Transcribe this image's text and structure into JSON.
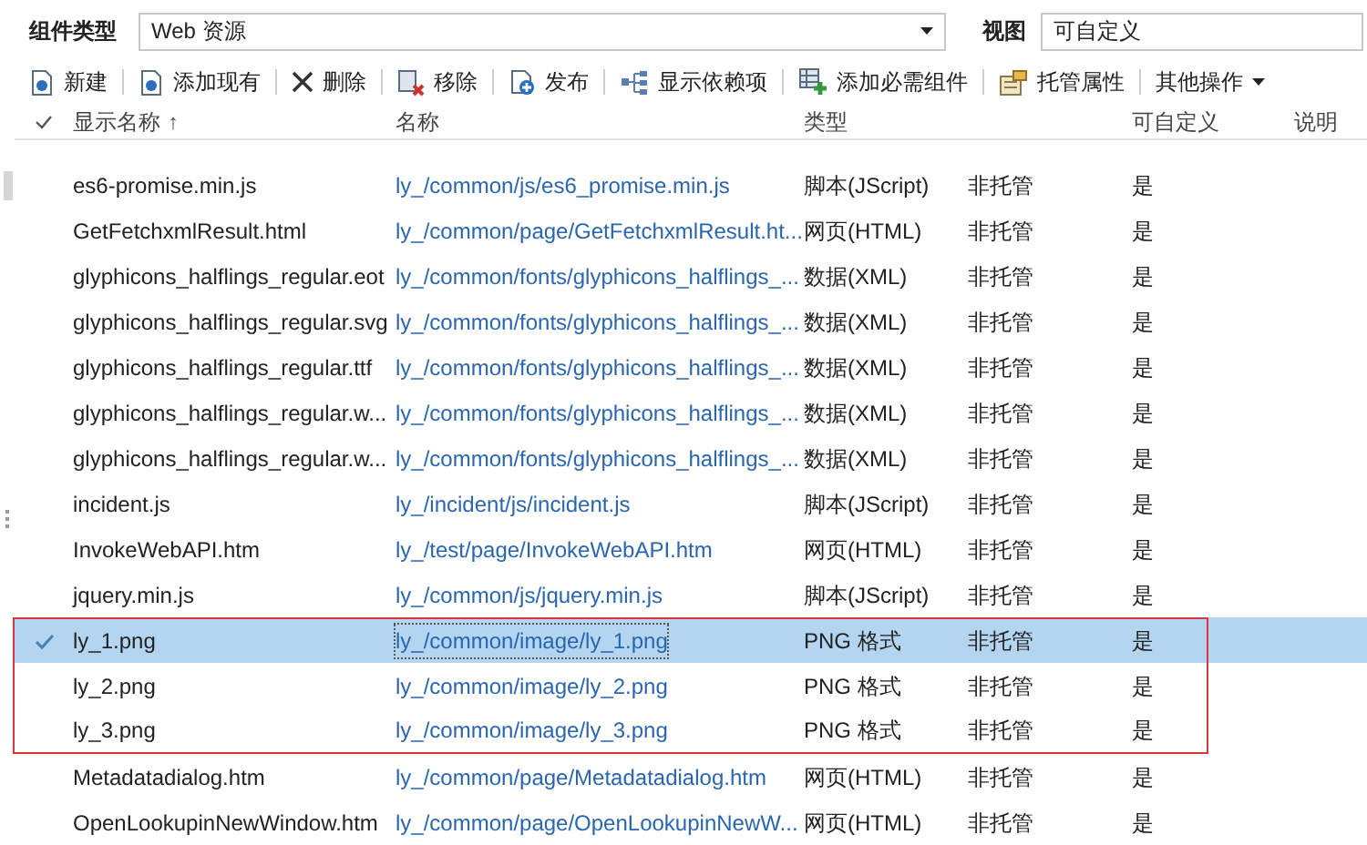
{
  "filter_bar": {
    "component_type_label": "组件类型",
    "component_type_value": "Web 资源",
    "view_label": "视图",
    "view_value": "可自定义"
  },
  "toolbar": [
    {
      "kind": "new",
      "label": "新建"
    },
    {
      "kind": "add",
      "label": "添加现有"
    },
    {
      "kind": "delete",
      "label": "删除"
    },
    {
      "kind": "remove",
      "label": "移除"
    },
    {
      "kind": "publish",
      "label": "发布"
    },
    {
      "kind": "deps",
      "label": "显示依赖项"
    },
    {
      "kind": "required",
      "label": "添加必需组件"
    },
    {
      "kind": "props",
      "label": "托管属性"
    },
    {
      "kind": "more",
      "label": "其他操作"
    }
  ],
  "table": {
    "columns": [
      {
        "label": "显示名称",
        "sort": "↑"
      },
      {
        "label": "名称"
      },
      {
        "label": "类型"
      },
      {
        "label": "可自定义"
      },
      {
        "label": "说明"
      }
    ],
    "rows": [
      {
        "display_name": "es6-promise.min.js",
        "name": "ly_/common/js/es6_promise.min.js",
        "type": "脚本(JScript)",
        "managed": "非托管",
        "customizable": "是",
        "selected": false,
        "highlighted": false
      },
      {
        "display_name": "GetFetchxmlResult.html",
        "name": "ly_/common/page/GetFetchxmlResult.ht...",
        "type": "网页(HTML)",
        "managed": "非托管",
        "customizable": "是",
        "selected": false,
        "highlighted": false
      },
      {
        "display_name": "glyphicons_halflings_regular.eot",
        "name": "ly_/common/fonts/glyphicons_halflings_...",
        "type": "数据(XML)",
        "managed": "非托管",
        "customizable": "是",
        "selected": false,
        "highlighted": false
      },
      {
        "display_name": "glyphicons_halflings_regular.svg",
        "name": "ly_/common/fonts/glyphicons_halflings_...",
        "type": "数据(XML)",
        "managed": "非托管",
        "customizable": "是",
        "selected": false,
        "highlighted": false
      },
      {
        "display_name": "glyphicons_halflings_regular.ttf",
        "name": "ly_/common/fonts/glyphicons_halflings_...",
        "type": "数据(XML)",
        "managed": "非托管",
        "customizable": "是",
        "selected": false,
        "highlighted": false
      },
      {
        "display_name": "glyphicons_halflings_regular.w...",
        "name": "ly_/common/fonts/glyphicons_halflings_...",
        "type": "数据(XML)",
        "managed": "非托管",
        "customizable": "是",
        "selected": false,
        "highlighted": false
      },
      {
        "display_name": "glyphicons_halflings_regular.w...",
        "name": "ly_/common/fonts/glyphicons_halflings_...",
        "type": "数据(XML)",
        "managed": "非托管",
        "customizable": "是",
        "selected": false,
        "highlighted": false
      },
      {
        "display_name": "incident.js",
        "name": "ly_/incident/js/incident.js",
        "type": "脚本(JScript)",
        "managed": "非托管",
        "customizable": "是",
        "selected": false,
        "highlighted": false
      },
      {
        "display_name": "InvokeWebAPI.htm",
        "name": "ly_/test/page/InvokeWebAPI.htm",
        "type": "网页(HTML)",
        "managed": "非托管",
        "customizable": "是",
        "selected": false,
        "highlighted": false
      },
      {
        "display_name": "jquery.min.js",
        "name": "ly_/common/js/jquery.min.js",
        "type": "脚本(JScript)",
        "managed": "非托管",
        "customizable": "是",
        "selected": false,
        "highlighted": false
      },
      {
        "display_name": "ly_1.png",
        "name": "ly_/common/image/ly_1.png",
        "type": "PNG 格式",
        "managed": "非托管",
        "customizable": "是",
        "selected": true,
        "highlighted": true
      },
      {
        "display_name": "ly_2.png",
        "name": "ly_/common/image/ly_2.png",
        "type": "PNG 格式",
        "managed": "非托管",
        "customizable": "是",
        "selected": false,
        "highlighted": true
      },
      {
        "display_name": "ly_3.png",
        "name": "ly_/common/image/ly_3.png",
        "type": "PNG 格式",
        "managed": "非托管",
        "customizable": "是",
        "selected": false,
        "highlighted": true
      },
      {
        "display_name": "Metadatadialog.htm",
        "name": "ly_/common/page/Metadatadialog.htm",
        "type": "网页(HTML)",
        "managed": "非托管",
        "customizable": "是",
        "selected": false,
        "highlighted": false
      },
      {
        "display_name": "OpenLookupinNewWindow.htm",
        "name": "ly_/common/page/OpenLookupinNewW...",
        "type": "网页(HTML)",
        "managed": "非托管",
        "customizable": "是",
        "selected": false,
        "highlighted": false
      }
    ]
  }
}
